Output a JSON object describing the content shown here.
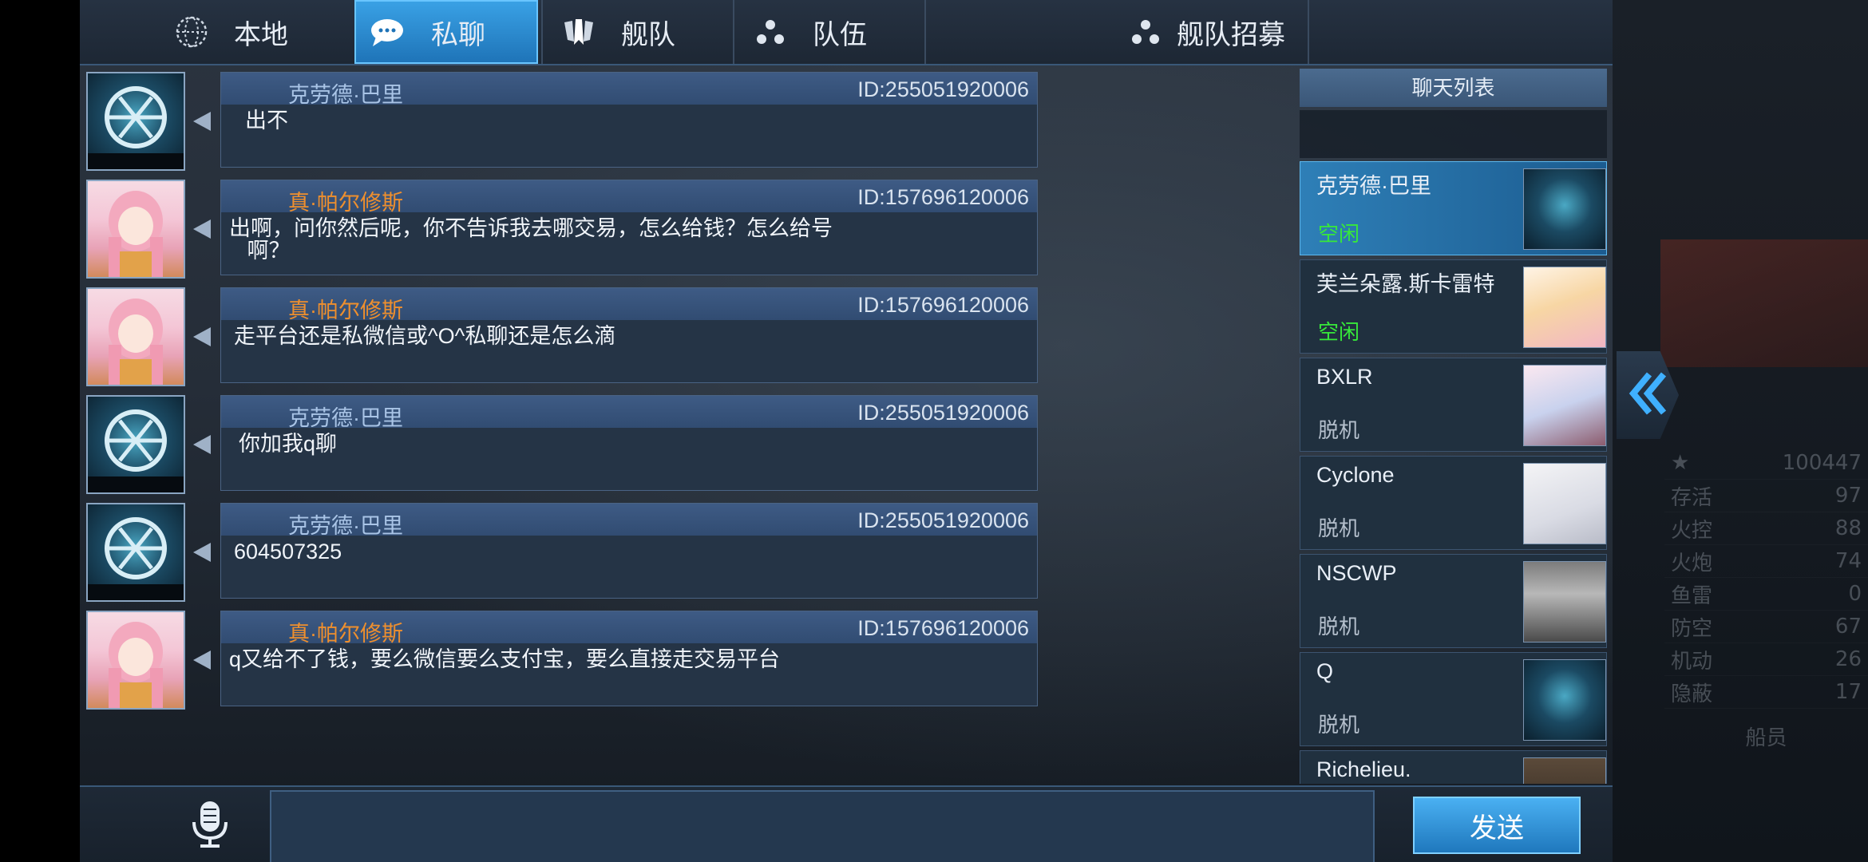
{
  "tabs": [
    {
      "label": "本地",
      "icon": "globe-icon"
    },
    {
      "label": "私聊",
      "icon": "chat-bubble-icon",
      "active": true
    },
    {
      "label": "舰队",
      "icon": "fleet-emblem-icon"
    },
    {
      "label": "队伍",
      "icon": "team-dots-icon"
    },
    {
      "label": "舰队招募",
      "icon": "team-dots-icon"
    }
  ],
  "messages": [
    {
      "sender": "克劳德·巴里",
      "id": "ID:255051920006",
      "text": "出不",
      "avatar": "fleet-logo-avatar"
    },
    {
      "sender": "真·帕尔修斯",
      "id": "ID:157696120006",
      "text": "出啊，问你然后呢，你不告诉我去哪交易，怎么给钱？怎么给号\n   啊？",
      "avatar": "anime-girl-avatar"
    },
    {
      "sender": "真·帕尔修斯",
      "id": "ID:157696120006",
      "text": "走平台还是私微信或^O^私聊还是怎么滴",
      "avatar": "anime-girl-avatar"
    },
    {
      "sender": "克劳德·巴里",
      "id": "ID:255051920006",
      "text": "你加我q聊",
      "avatar": "fleet-logo-avatar"
    },
    {
      "sender": "克劳德·巴里",
      "id": "ID:255051920006",
      "text": "604507325",
      "avatar": "fleet-logo-avatar"
    },
    {
      "sender": "真·帕尔修斯",
      "id": "ID:157696120006",
      "text": "q又给不了钱，要么微信要么支付宝，要么直接走交易平台",
      "avatar": "anime-girl-avatar"
    }
  ],
  "chat_list": {
    "title": "聊天列表",
    "contacts": [
      {
        "name": "克劳德·巴里",
        "status": "空闲"
      },
      {
        "name": "芙兰朵露.斯卡雷特",
        "status": "空闲"
      },
      {
        "name": "BXLR",
        "status": "脱机"
      },
      {
        "name": "Cyclone",
        "status": "脱机"
      },
      {
        "name": "NSCWP",
        "status": "脱机"
      },
      {
        "name": "Q",
        "status": "脱机"
      },
      {
        "name": "Richelieu.",
        "status": ""
      }
    ]
  },
  "composer": {
    "value": "",
    "send_label": "发送"
  },
  "background": {
    "rating": "100447",
    "stats": [
      {
        "label": "存活",
        "value": "97"
      },
      {
        "label": "火控",
        "value": "88"
      },
      {
        "label": "火炮",
        "value": "74"
      },
      {
        "label": "鱼雷",
        "value": "0"
      },
      {
        "label": "防空",
        "value": "67"
      },
      {
        "label": "机动",
        "value": "26"
      },
      {
        "label": "隐蔽",
        "value": "17"
      }
    ],
    "bottom_button": "船员"
  },
  "colors": {
    "accent_blue": "#2e8fd8",
    "sender_orange": "#ee8f2e",
    "status_online": "#37e83a"
  }
}
